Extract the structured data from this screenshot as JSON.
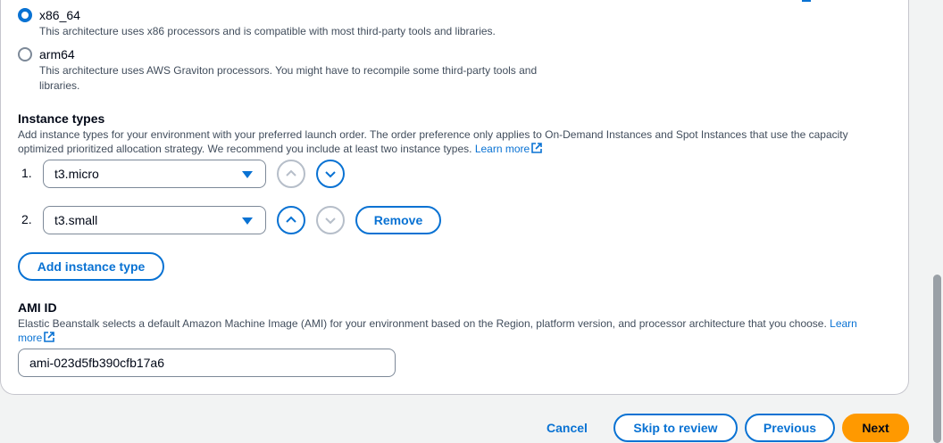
{
  "architecture": {
    "options": [
      {
        "label": "x86_64",
        "description": "This architecture uses x86 processors and is compatible with most third-party tools and libraries.",
        "selected": true
      },
      {
        "label": "arm64",
        "description_line1": "This architecture uses AWS Graviton processors. You might have to recompile some third-party tools and",
        "description_line2": "libraries.",
        "selected": false
      }
    ]
  },
  "instance_types": {
    "title": "Instance types",
    "description_line1": "Add instance types for your environment with your preferred launch order. The order preference only applies to On-Demand Instances and Spot Instances that use the capacity",
    "description_line2": "optimized prioritized allocation strategy. We recommend you include at least two instance types.",
    "learn_more": "Learn more",
    "rows": [
      {
        "number": "1.",
        "value": "t3.micro"
      },
      {
        "number": "2.",
        "value": "t3.small",
        "remove_label": "Remove"
      }
    ],
    "add_label": "Add instance type"
  },
  "ami": {
    "title": "AMI ID",
    "description": "Elastic Beanstalk selects a default Amazon Machine Image (AMI) for your environment based on the Region, platform version, and processor architecture that you choose.",
    "learn_more_part1": "Learn",
    "learn_more_part2": "more",
    "value": "ami-023d5fb390cfb17a6"
  },
  "footer": {
    "cancel": "Cancel",
    "skip": "Skip to review",
    "previous": "Previous",
    "next": "Next"
  },
  "colors": {
    "accent": "#0972d3",
    "primary": "#ff9900",
    "text": "#000716",
    "muted": "#414d5c"
  },
  "icons": [
    "external-link-icon",
    "chevron-up-icon",
    "chevron-down-icon",
    "caret-down-icon"
  ]
}
